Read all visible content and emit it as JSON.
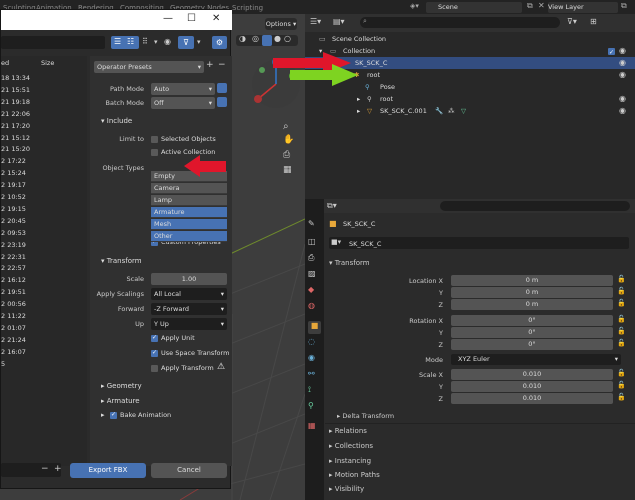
{
  "topbar": {
    "tabs": [
      "Sculpting",
      "Animation",
      "Rendering",
      "Compositing",
      "Geometry Nodes",
      "Scripting"
    ],
    "scene": "Scene",
    "view_layer": "View Layer"
  },
  "dialog": {
    "title_buttons": {
      "minimize": "—",
      "maximize": "☐",
      "close": "✕"
    },
    "columns": {
      "date": "ed",
      "size": "Size"
    },
    "dates": [
      "18 13:34",
      "21 15:51",
      "21 19:18",
      "21 22:06",
      "21 17:20",
      "21 15:12",
      "21 15:20",
      "2 17:22",
      "2 15:24",
      "2 19:17",
      "2 10:52",
      "2 19:15",
      "2 20:45",
      "2 09:53",
      "2 23:19",
      "2 22:31",
      "2 22:57",
      "2 16:12",
      "2 19:51",
      "2 00:56",
      "2 11:22",
      "2 01:07",
      "2 21:24",
      "2 16:07",
      "5"
    ],
    "operator_presets": "Operator Presets",
    "path_mode_label": "Path Mode",
    "path_mode_value": "Auto",
    "batch_mode_label": "Batch Mode",
    "batch_mode_value": "Off",
    "include_header": "Include",
    "limit_to_label": "Limit to",
    "selected_objects": "Selected Objects",
    "active_collection": "Active Collection",
    "object_types_label": "Object Types",
    "object_types": [
      {
        "name": "Empty",
        "selected": false
      },
      {
        "name": "Camera",
        "selected": false
      },
      {
        "name": "Lamp",
        "selected": false
      },
      {
        "name": "Armature",
        "selected": true
      },
      {
        "name": "Mesh",
        "selected": true
      },
      {
        "name": "Other",
        "selected": true
      }
    ],
    "custom_properties": "Custom Properties",
    "transform_header": "Transform",
    "scale_label": "Scale",
    "scale_value": "1.00",
    "apply_scalings_label": "Apply Scalings",
    "apply_scalings_value": "All Local",
    "forward_label": "Forward",
    "forward_value": "-Z Forward",
    "up_label": "Up",
    "up_value": "Y Up",
    "apply_unit": "Apply Unit",
    "use_space_transform": "Use Space Transform",
    "apply_transform": "Apply Transform",
    "geometry_header": "Geometry",
    "armature_header": "Armature",
    "bake_animation": "Bake Animation",
    "minus": "−",
    "plus": "+",
    "export_button": "Export FBX",
    "cancel_button": "Cancel"
  },
  "viewport": {
    "options": "Options"
  },
  "outliner": {
    "rows": [
      {
        "label": "Scene Collection"
      },
      {
        "label": "Collection"
      },
      {
        "label": "SK_SCK_C"
      },
      {
        "label": "root"
      },
      {
        "label": "Pose"
      },
      {
        "label": "root"
      },
      {
        "label": "SK_SCK_C.001"
      }
    ]
  },
  "properties": {
    "object_name": "SK_SCK_C",
    "object_field": "SK_SCK_C",
    "transform_header": "Transform",
    "location_x_label": "Location X",
    "y_label": "Y",
    "z_label": "Z",
    "location": [
      "0 m",
      "0 m",
      "0 m"
    ],
    "rotation_x_label": "Rotation X",
    "rotation": [
      "0°",
      "0°",
      "0°"
    ],
    "mode_label": "Mode",
    "mode_value": "XYZ Euler",
    "scale_x_label": "Scale X",
    "scale": [
      "0.010",
      "0.010",
      "0.010"
    ],
    "delta_transform": "Delta Transform",
    "sections": [
      "Relations",
      "Collections",
      "Instancing",
      "Motion Paths",
      "Visibility"
    ]
  },
  "colors": {
    "accent_blue": "#4772b3",
    "arrow_red": "#e0162b",
    "arrow_green": "#7ed321"
  }
}
